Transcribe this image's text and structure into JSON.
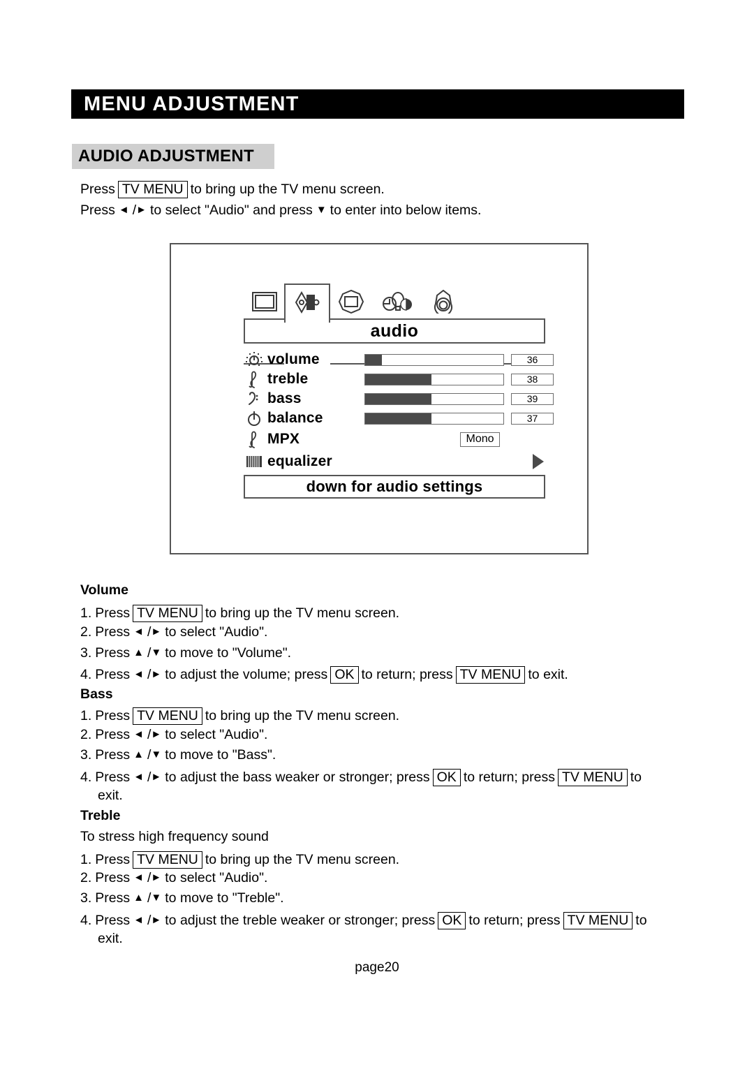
{
  "page": {
    "header_title": "MENU ADJUSTMENT",
    "section_heading": "AUDIO ADJUSTMENT",
    "footer": "page20",
    "colors": {
      "header_bg": "#000000",
      "header_fg": "#ffffff",
      "section_heading_bg": "#cfcfcf",
      "osd_border": "#555555",
      "bar_fill": "#4a4a4a"
    }
  },
  "intro": {
    "line1": {
      "pre": "Press",
      "key": "TV MENU",
      "post": "to bring up the TV menu screen."
    },
    "line2": {
      "pre": "Press",
      "left_arrow": "◄",
      "slash": "/",
      "right_arrow": "►",
      "mid": "to select \"Audio\" and press",
      "down_arrow": "▼",
      "post": "to enter into below items."
    }
  },
  "osd": {
    "title": "audio",
    "hint": "down for audio settings",
    "tabs": [
      {
        "name": "picture",
        "icon": "picture-tab-icon",
        "active": false
      },
      {
        "name": "audio",
        "icon": "audio-tab-icon",
        "active": true
      },
      {
        "name": "screen",
        "icon": "screen-tab-icon",
        "active": false
      },
      {
        "name": "function",
        "icon": "function-tab-icon",
        "active": false
      },
      {
        "name": "setup",
        "icon": "setup-tab-icon",
        "active": false
      }
    ],
    "rows": [
      {
        "label": "volume",
        "icon": "brightness-dial-icon",
        "type": "bar",
        "value": "36",
        "fill_percent": 12
      },
      {
        "label": "treble",
        "icon": "treble-clef-icon",
        "type": "bar",
        "value": "38",
        "fill_percent": 48
      },
      {
        "label": "bass",
        "icon": "bass-clef-icon",
        "type": "bar",
        "value": "39",
        "fill_percent": 48
      },
      {
        "label": "balance",
        "icon": "balance-dial-icon",
        "type": "bar",
        "value": "37",
        "fill_percent": 48
      },
      {
        "label": "MPX",
        "icon": "treble-clef-icon",
        "type": "option",
        "value": "Mono"
      },
      {
        "label": "equalizer",
        "icon": "equalizer-bars-icon",
        "type": "submenu",
        "value": ""
      }
    ]
  },
  "sections": [
    {
      "title": "Volume",
      "note": "",
      "steps": [
        {
          "num": "1.",
          "pre": "Press",
          "key1": "TV MENU",
          "post": "to bring up the TV menu screen."
        },
        {
          "num": "2.",
          "pre": "Press",
          "arrows": "lr",
          "post": "to select \"Audio\"."
        },
        {
          "num": "3.",
          "pre": "Press",
          "arrows": "ud",
          "post": "to move to \"Volume\"."
        },
        {
          "num": "4.",
          "pre": "Press",
          "arrows": "lr",
          "mid1": "to adjust the volume; press",
          "key1": "OK",
          "mid2": "to return; press",
          "key2": "TV MENU",
          "post": "to exit."
        }
      ]
    },
    {
      "title": "Bass",
      "note": "",
      "steps": [
        {
          "num": "1.",
          "pre": "Press",
          "key1": "TV MENU",
          "post": "to bring up the TV menu screen."
        },
        {
          "num": "2.",
          "pre": "Press",
          "arrows": "lr",
          "post": "to select \"Audio\"."
        },
        {
          "num": "3.",
          "pre": "Press",
          "arrows": "ud",
          "post": "to move to \"Bass\"."
        },
        {
          "num": "4.",
          "pre": "Press",
          "arrows": "lr",
          "mid1": "to adjust the bass weaker or stronger; press",
          "key1": "OK",
          "mid2": "to return; press",
          "key2": "TV MENU",
          "post": "to",
          "wrap": "exit."
        }
      ]
    },
    {
      "title": "Treble",
      "note": "To stress high frequency sound",
      "steps": [
        {
          "num": "1.",
          "pre": "Press",
          "key1": "TV MENU",
          "post": "to bring up the TV menu screen."
        },
        {
          "num": "2.",
          "pre": "Press",
          "arrows": "lr",
          "post": "to select \"Audio\"."
        },
        {
          "num": "3.",
          "pre": "Press",
          "arrows": "ud",
          "post": "to move to \"Treble\"."
        },
        {
          "num": "4.",
          "pre": "Press",
          "arrows": "lr",
          "mid1": "to adjust the treble weaker or stronger; press",
          "key1": "OK",
          "mid2": "to return; press",
          "key2": "TV MENU",
          "post": "to",
          "wrap": "exit."
        }
      ]
    }
  ]
}
